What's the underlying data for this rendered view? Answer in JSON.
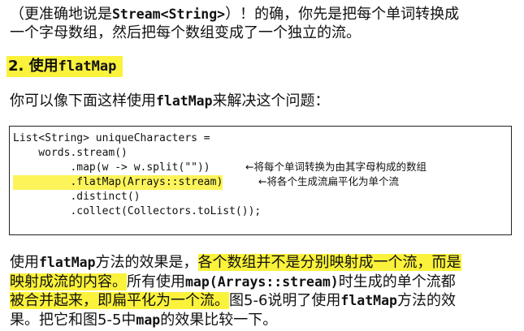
{
  "intro": {
    "line1_a": "（更准确地说是",
    "line1_code": "Stream<String>",
    "line1_b": "）！的确，你先是把每个单词转换成",
    "line2": "一个字母数组，然后把每个数组变成了一个独立的流。"
  },
  "heading": {
    "number": "2.",
    "prefix": "使用",
    "code": "flatMap"
  },
  "lead": {
    "a": "你可以像下面这样使用",
    "code": "flatMap",
    "b": "来解决这个问题："
  },
  "code": {
    "lines": [
      "List<String> uniqueCharacters =",
      "    words.stream()",
      "         .map(w -> w.split(\"\"))",
      "         .flatMap(Arrays::stream)",
      "         .distinct()",
      "         .collect(Collectors.toList());"
    ],
    "notes": [
      "←将每个单词转换为由其字母构成的数组",
      "←将各个生成流扁平化为单个流"
    ]
  },
  "conclusion": {
    "l1_a": "使用",
    "l1_code": "flatMap",
    "l1_b": "方法的效果是，",
    "l1_hl": "各个数组并不是分别映射成一个流，而是",
    "l2_hl": "映射成流的内容。",
    "l2_a": "所有使用",
    "l2_code": "map(Arrays::stream)",
    "l2_b": "时生成的单个流都",
    "l3_hl": "被合并起来，即扁平化为一个流。",
    "l3_a": "图5-6说明了使用",
    "l3_code": "flatMap",
    "l3_b": "方法的效",
    "l4_a": "果。把它和图5-5中",
    "l4_code": "map",
    "l4_b": "的效果比较一下。"
  },
  "colors": {
    "highlight": "#fbf23b",
    "text": "#111111",
    "border": "#222222"
  }
}
